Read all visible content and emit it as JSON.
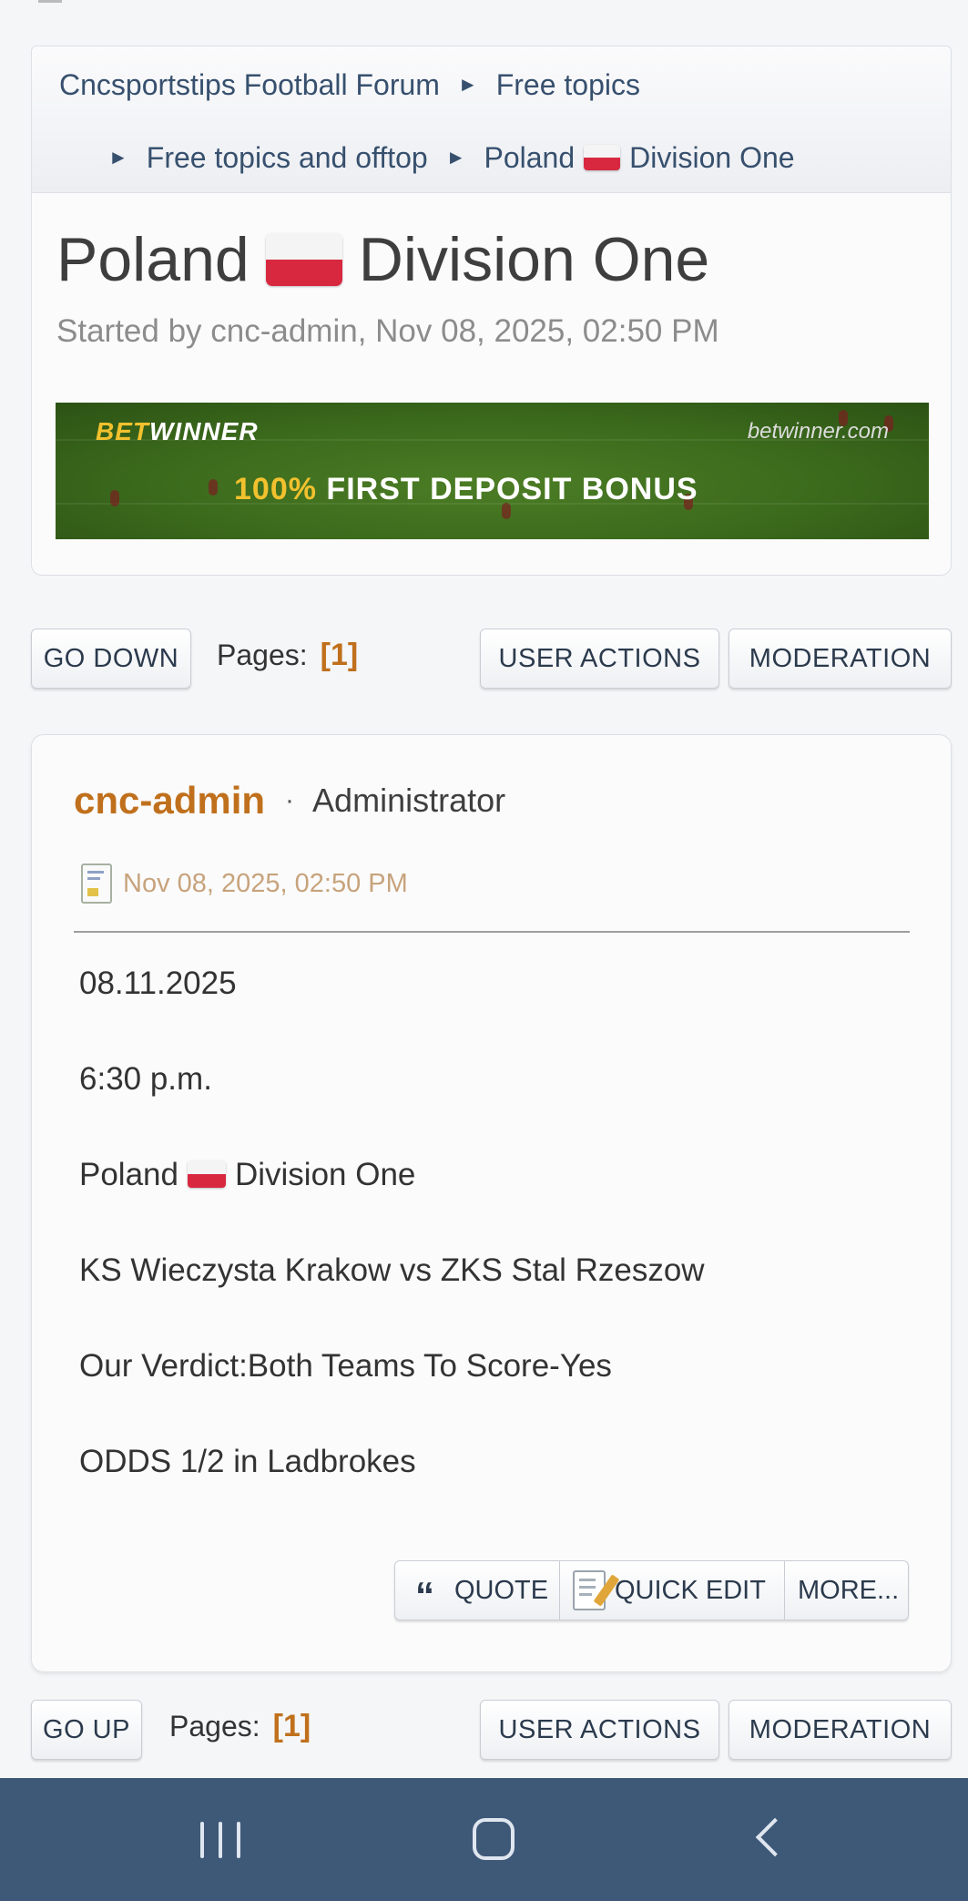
{
  "breadcrumb": {
    "items": [
      "Cncsportstips Football Forum",
      "Free topics",
      "Free topics and offtop",
      "Poland",
      "Division One"
    ]
  },
  "topic": {
    "title_part1": "Poland",
    "title_part2": "Division One",
    "started_by": "Started by cnc-admin, Nov 08, 2025, 02:50 PM"
  },
  "banner": {
    "brand_bet": "BET",
    "brand_winner": "WINNER",
    "site": "betwinner.com",
    "promo_pct": "100%",
    "promo_text": "FIRST DEPOSIT BONUS"
  },
  "top_controls": {
    "go_down": "GO DOWN",
    "pages_label": "Pages:",
    "current_page": "[1]",
    "user_actions": "USER ACTIONS",
    "moderation": "MODERATION"
  },
  "post": {
    "author": "cnc-admin",
    "separator": "·",
    "role": "Administrator",
    "date": "Nov 08, 2025, 02:50 PM",
    "lines": {
      "date": "08.11.2025",
      "time": "6:30 p.m.",
      "league_part1": "Poland",
      "league_part2": "Division One",
      "match": "KS Wieczysta Krakow vs ZKS Stal Rzeszow",
      "verdict": "Our Verdict:Both Teams To Score-Yes",
      "odds": "ODDS 1/2 in Ladbrokes"
    },
    "actions": {
      "quote": "QUOTE",
      "quick_edit": "QUICK EDIT",
      "more": "MORE..."
    }
  },
  "bottom_controls": {
    "go_up": "GO UP",
    "pages_label": "Pages:",
    "current_page": "[1]",
    "user_actions": "USER ACTIONS",
    "moderation": "MODERATION"
  },
  "colors": {
    "accent": "#c0701c",
    "link": "#37506e",
    "navbar": "#3e5878",
    "flag_red": "#d8283f"
  },
  "icons": [
    "breadcrumb-arrow-icon",
    "poland-flag-icon",
    "document-icon",
    "quote-icon",
    "edit-icon",
    "recents-icon",
    "home-icon",
    "back-icon"
  ]
}
